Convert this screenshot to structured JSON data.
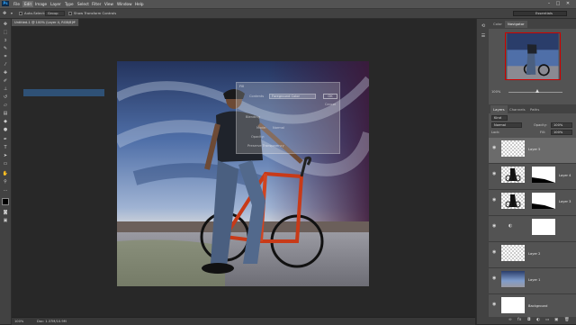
{
  "menubar": {
    "logo": "Ps",
    "items": [
      "File",
      "Edit",
      "Image",
      "Layer",
      "Type",
      "Select",
      "Filter",
      "View",
      "Window",
      "Help"
    ],
    "active_index": 1,
    "window_buttons": [
      "–",
      "□",
      "✕"
    ]
  },
  "options": {
    "auto_select_label": "Auto-Select:",
    "auto_select_value": "Group",
    "show_transform_label": "Show Transform Controls",
    "workspace": "Essentials"
  },
  "document": {
    "tab_title": "Untitled-1 @ 100% (Layer 4, RGB/8) *",
    "close": "×",
    "zoom": "100%",
    "doc_info": "Doc: 1.37M/10.9M"
  },
  "fill_dialog": {
    "title": "Fill",
    "contents_label": "Contents",
    "contents_value": "Foreground Color",
    "ok_label": "OK",
    "cancel_label": "Cancel",
    "blending_label": "Blending",
    "mode_label": "Mode:",
    "mode_value": "Normal",
    "opacity_label": "Opacity:",
    "preserve_label": "Preserve Transparency"
  },
  "panels": {
    "top_tabs": [
      "Color",
      "Navigator"
    ],
    "nav_zoom": "100%",
    "layer_tabs": [
      "Layers",
      "Channels",
      "Paths"
    ],
    "kind_label": "Kind",
    "blend_mode": "Normal",
    "opacity_label": "Opacity:",
    "opacity_value": "100%",
    "lock_label": "Lock:",
    "fill_label": "Fill:",
    "fill_value": "100%",
    "layers": [
      {
        "name": "Layer 5",
        "thumb": "checker",
        "mask": false,
        "selected": true
      },
      {
        "name": "Layer 4",
        "thumb": "photo",
        "mask": true,
        "selected": false
      },
      {
        "name": "Layer 3",
        "thumb": "photo",
        "mask": true,
        "selected": false
      },
      {
        "name": "",
        "thumb": "adjust",
        "mask": true,
        "selected": false
      },
      {
        "name": "Layer 2",
        "thumb": "checker",
        "mask": false,
        "selected": false
      },
      {
        "name": "Layer 1",
        "thumb": "sky",
        "mask": false,
        "selected": false
      },
      {
        "name": "Background",
        "thumb": "white",
        "mask": false,
        "selected": false
      }
    ],
    "footer_icons": [
      "link-icon",
      "fx-icon",
      "mask-icon",
      "adjustment-icon",
      "folder-icon",
      "new-layer-icon",
      "trash-icon"
    ]
  },
  "colors": {
    "ui_dark": "#282828",
    "panel": "#424242",
    "accent_selection": "#2f5176"
  }
}
